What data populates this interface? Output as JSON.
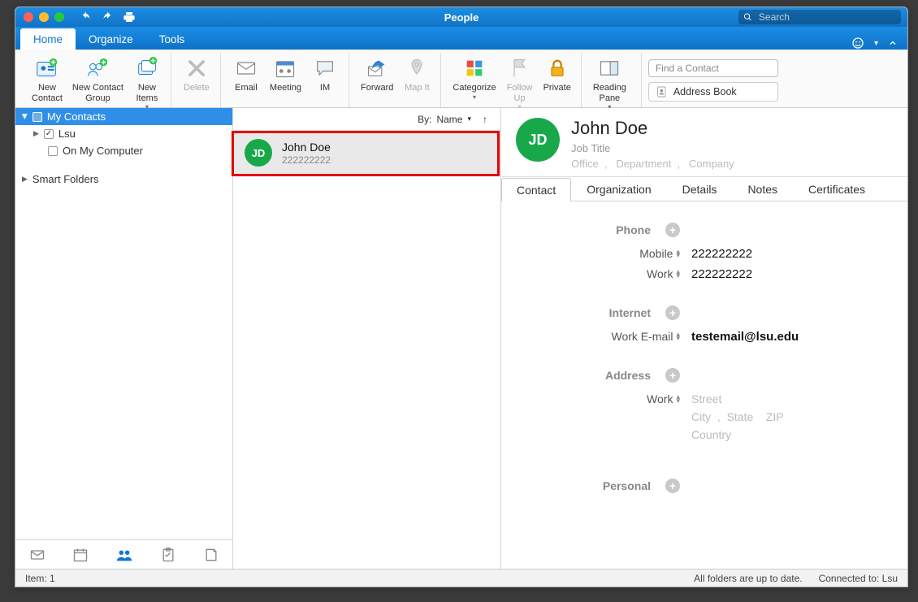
{
  "window": {
    "title": "People"
  },
  "search": {
    "placeholder": "Search"
  },
  "tabs": {
    "home": "Home",
    "organize": "Organize",
    "tools": "Tools"
  },
  "ribbon": {
    "new_contact": "New\nContact",
    "new_contact_group": "New Contact\nGroup",
    "new_items": "New\nItems",
    "delete": "Delete",
    "email": "Email",
    "meeting": "Meeting",
    "im": "IM",
    "forward": "Forward",
    "map_it": "Map It",
    "categorize": "Categorize",
    "follow_up": "Follow\nUp",
    "private": "Private",
    "reading_pane": "Reading\nPane",
    "find_placeholder": "Find a Contact",
    "address_book": "Address Book"
  },
  "sidebar": {
    "my_contacts": "My Contacts",
    "lsu": "Lsu",
    "on_my_computer": "On My Computer",
    "smart_folders": "Smart Folders"
  },
  "list": {
    "sort_prefix": "By:",
    "sort_field": "Name",
    "items": [
      {
        "initials": "JD",
        "name": "John Doe",
        "sub": "222222222"
      }
    ]
  },
  "contact": {
    "initials": "JD",
    "name": "John Doe",
    "job_title_ph": "Job Title",
    "office_ph": "Office",
    "department_ph": "Department",
    "company_ph": "Company",
    "tabs": {
      "contact": "Contact",
      "organization": "Organization",
      "details": "Details",
      "notes": "Notes",
      "certificates": "Certificates"
    },
    "sections": {
      "phone": "Phone",
      "internet": "Internet",
      "address": "Address",
      "personal": "Personal"
    },
    "phone": {
      "mobile_label": "Mobile",
      "mobile": "222222222",
      "work_label": "Work",
      "work": "222222222"
    },
    "internet": {
      "work_email_label": "Work E-mail",
      "work_email": "testemail@lsu.edu"
    },
    "address": {
      "work_label": "Work",
      "street_ph": "Street",
      "city_ph": "City",
      "state_ph": "State",
      "zip_ph": "ZIP",
      "country_ph": "Country"
    }
  },
  "status": {
    "item_count": "Item: 1",
    "folders": "All folders are up to date.",
    "connected": "Connected to: Lsu"
  }
}
